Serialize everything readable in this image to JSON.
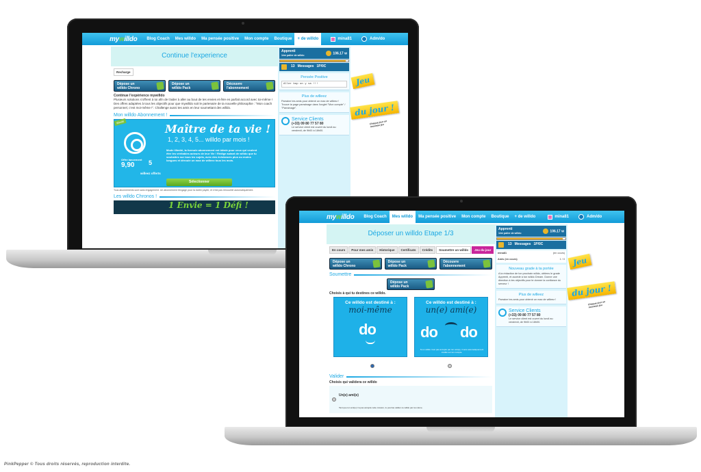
{
  "colors": {
    "accent": "#1ba8e3",
    "green": "#7bc23c",
    "pink": "#c9269b",
    "yellow": "#f5c500"
  },
  "site": {
    "logo_pre": "my",
    "logo_mid": "w",
    "logo_post": "illdo",
    "user_name": "mina81",
    "admin_label": "Adm/do"
  },
  "laptop_a": {
    "nav": [
      "Blog Coach",
      "Mes willdo",
      "Ma pensée positive",
      "Mon compte",
      "Boutique",
      "+ de willdo"
    ],
    "active_nav": 5,
    "page_title": "Continue l'experience",
    "tab": "Recharge",
    "packs": [
      {
        "line1": "Dépose un",
        "line2": "willdo Chrono"
      },
      {
        "line1": "Dépose un",
        "line2": "willdo Pack"
      },
      {
        "line1": "Découvre",
        "line2": "l'abonnement"
      }
    ],
    "intro_title": "Continue l'expérience mywilldo",
    "intro_text": "Plusieurs solutions s'offrent à toi afin de t'aider à aller au bout de tes envies et être en parfait accord avec toi-même ! Des offres adaptées à tous les objectifs pour que mywilldo soit le partenaire de ta nouvelle philosophie : \"Mon coach personnel, c'est moi-même !\". Challenge aussi tes amis en leur soumettant des willdo.",
    "section1": "Mon willdo Abonnement !",
    "promo": {
      "ribbon": "Illimité",
      "headline": "Maître de ta vie !",
      "numbers": "1, 2, 3, 4, 5... willdo par mois !",
      "desc": "Mode illimité, la formule abonnement est idéale pour ceux qui veulent être les véritables acteurs de leur Vie ! Rédige autant de willdo que tu souhaites sur tous les sujets, avec des échéances plus ou moins longues et déroule un max de willeez tous les mois.",
      "price_label": "Offre lancement",
      "price": "9,90",
      "offer": "5",
      "offer_label": "willeez offerts",
      "select": "Sélectionner"
    },
    "promo_note": "Tous abonnements sont sans engagement. Un abonnement t'engage pour la durée payée, et n'est pas renouvelé automatiquement.",
    "section2": "Les willdo Chronos !",
    "promo2": "1 Envie = 1 Défi !",
    "side": {
      "grade": "Apprenti",
      "grade_sub": "1ère palier de willdo",
      "score": "106.17",
      "unit": "w",
      "messages": "13",
      "messages_label": "Messages",
      "ratio": "1P/0C",
      "pensee_title": "Pensée Positive",
      "pensee_text": "Aller bop on y va !!!",
      "willeez_title": "Plus de willeez",
      "willeez_text": "Parraine tes amis pour obtenir un max de willeez ! Trouve la page parrainage dans l'onglet \"Mon compte\" / \"Parrainage\".",
      "service_title": "Service Clients",
      "service_phone": "(+33) 09 80 77 57 80",
      "service_text": "Le service client est ouvert du lundi au vendredi, de 9h00 à 18h00."
    },
    "jeu": "Jeu",
    "dujour": "du jour !",
    "tag_sub": "Chaque jour un nouveau jeu"
  },
  "laptop_b": {
    "nav": [
      "Blog Coach",
      "Mes willdo",
      "Ma pensée positive",
      "Mon compte",
      "Boutique",
      "+ de willdo"
    ],
    "active_nav": 1,
    "page_title": "Déposer un willdo Etape 1/3",
    "tabs": [
      "En cours",
      "Pour mes amis",
      "Historique",
      "Certificats",
      "Crédits",
      "Soumettre un willdo",
      "Jeu du jour"
    ],
    "packs": [
      {
        "line1": "Dépose un",
        "line2": "willdo Chrono"
      },
      {
        "line1": "Dépose un",
        "line2": "willdo Pack"
      },
      {
        "line1": "Découvre",
        "line2": "l'abonnement"
      }
    ],
    "section1": "Soumettre",
    "pack_single": {
      "line1": "Dépose un",
      "line2": "willdo Pack"
    },
    "choose": "Choisis à qui tu destines ce willdo.",
    "card1": {
      "title": "Ce willdo est destiné à :",
      "who": "moi-même",
      "do": "do"
    },
    "card2": {
      "title": "Ce willdo est destiné à :",
      "who": "un(e) ami(e)",
      "do1": "do",
      "do2": "do",
      "note": "Si un willdo n'est pas accepté par ton ami(e), il sera automatiquement crédité sur ton compte."
    },
    "section2": "Valider",
    "choose2": "Choisis qui validera ce willdo",
    "option1": "Un(e) ami(e)",
    "option1_note": "Tant que ton ami(e) n'a pas accepté cette mission, tu pourras valider ce willdo par toi-même.",
    "side": {
      "grade": "Apprenti",
      "grade_sub": "1ère palier de willdo",
      "score": "106.17",
      "unit": "w",
      "messages": "13",
      "messages_label": "Messages",
      "ratio": "1P/0C",
      "rank_user": "mina81",
      "rank_val": "(en cours)",
      "rank_user2": "Amis (en cours)",
      "rank_val2": "1 / 0",
      "grade_title": "Nouveau grade à ta portée",
      "grade_text": "A la rédaction de ton prochain willdo, obtiens le grade Apprenti, et accède à ton willdo Dream. Donne une direction à tes objectifs pour te donner la confiance du serveur !",
      "willeez_title": "Plus de willeez",
      "willeez_text": "Parraine tes amis pour obtenir un max de willeez !",
      "service_title": "Service Clients",
      "service_phone": "(+33) 09 80 77 57 80",
      "service_text": "Le service client est ouvert du lundi au vendredi, de 9h00 à 18h00."
    },
    "jeu": "Jeu",
    "dujour": "du jour !",
    "tag_sub": "Chaque jour un nouveau jeu"
  },
  "footer": "PinkPepper © Tous droits réservés, reproduction interdite."
}
